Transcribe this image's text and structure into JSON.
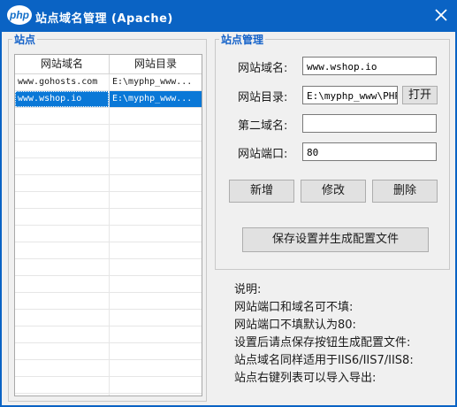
{
  "window": {
    "title": "站点域名管理 (Apache)",
    "logo_text": "php"
  },
  "sites_group": {
    "title": "站点",
    "columns": [
      "网站域名",
      "网站目录"
    ],
    "rows": [
      {
        "domain": "www.gohosts.com",
        "dir": "E:\\myphp_www..."
      },
      {
        "domain": "www.wshop.io",
        "dir": "E:\\myphp_www..."
      }
    ],
    "selected_index": 1
  },
  "manage_group": {
    "title": "站点管理",
    "domain_label": "网站域名:",
    "domain_value": "www.wshop.io",
    "dir_label": "网站目录:",
    "dir_value": "E:\\myphp_www\\PHPT",
    "open_label": "打开",
    "second_label": "第二域名:",
    "second_value": "",
    "port_label": "网站端口:",
    "port_value": "80",
    "add_label": "新增",
    "edit_label": "修改",
    "delete_label": "删除",
    "save_label": "保存设置并生成配置文件"
  },
  "notes": [
    "说明:",
    "网站端口和域名可不填:",
    "网站端口不填默认为80:",
    "设置后请点保存按钮生成配置文件:",
    "站点域名同样适用于IIS6/IIS7/IIS8:",
    "站点右键列表可以导入导出:"
  ]
}
